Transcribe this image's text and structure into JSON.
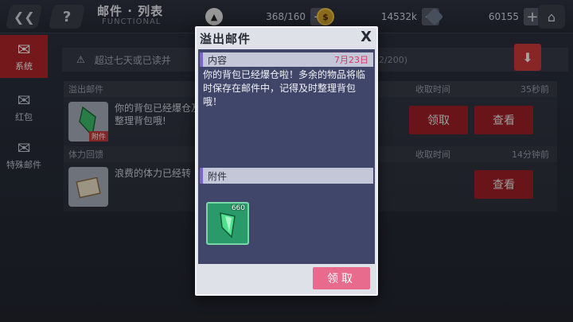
{
  "header": {
    "back_icon": "back-arrow-icon",
    "help_label": "?",
    "title": "邮件 · 列表",
    "subtitle": "FUNCTIONAL",
    "stamina": "368/160",
    "coins": "14532k",
    "gems": "60155",
    "plus": "+"
  },
  "sidebar": {
    "items": [
      {
        "label": "系统",
        "icon": "system-mail-icon",
        "active": true
      },
      {
        "label": "红包",
        "icon": "red-envelope-icon",
        "active": false
      },
      {
        "label": "特殊邮件",
        "icon": "special-mail-icon",
        "active": false
      }
    ]
  },
  "list": {
    "notice_text": "超过七天或已读并",
    "notice_count": "2/200)",
    "sections": [
      {
        "title": "溢出邮件",
        "time_header": "收取时间",
        "age": "35秒前",
        "preview": "你的背包已经爆仓及时整理背包哦!",
        "attach_badge": "附件",
        "claim": "领取",
        "view": "查看"
      },
      {
        "title": "体力回馈",
        "time_header": "收取时间",
        "age": "14分钟前",
        "preview": "浪费的体力已经转",
        "view": "查看"
      }
    ]
  },
  "modal": {
    "title": "溢出邮件",
    "close": "X",
    "content_label": "内容",
    "date": "7月23日",
    "body": "你的背包已经爆仓啦！多余的物品将临时保存在邮件中，记得及时整理背包哦！",
    "attach_label": "附件",
    "item_qty": "660",
    "claim_label": "领取"
  },
  "colors": {
    "accent_red": "#b3262c",
    "claim_pink": "#e86a8c",
    "date_pink": "#d43a6c",
    "modal_body": "#40466a"
  }
}
